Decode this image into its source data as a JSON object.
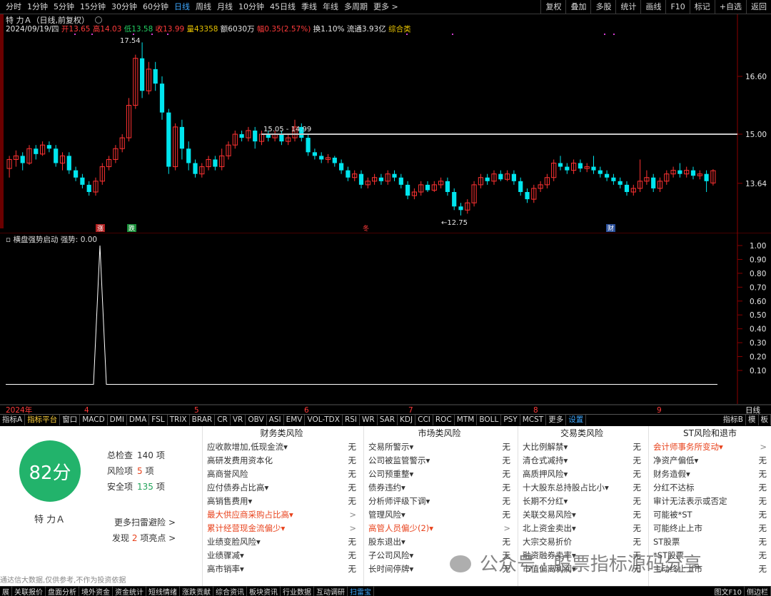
{
  "topbar": {
    "tabs": [
      "分时",
      "1分钟",
      "5分钟",
      "15分钟",
      "30分钟",
      "60分钟",
      "日线",
      "周线",
      "月线",
      "10分钟",
      "45日线",
      "季线",
      "年线",
      "多周期",
      "更多 >"
    ],
    "active_tab": "日线",
    "buttons": [
      "复权",
      "叠加",
      "多股",
      "统计",
      "画线",
      "F10",
      "标记",
      "+自选",
      "返回"
    ]
  },
  "title": {
    "text": "特 力Ａ（日线,前复权）"
  },
  "info": {
    "date": "2024/09/19/四",
    "open_label": "开",
    "open": "13.65",
    "high_label": "高",
    "high": "14.03",
    "low_label": "低",
    "low": "13.58",
    "close_label": "收",
    "close": "13.99",
    "vol_label": "量",
    "vol": "43358",
    "amt_label": "额",
    "amt": "6030万",
    "chg_label": "幅",
    "chg": "0.35(2.57%)",
    "turn_label": "换",
    "turn": "1.10%",
    "float_label": "流通",
    "float": "3.93亿",
    "sector": "综合类"
  },
  "main_chart": {
    "price_labels": [
      "16.60",
      "15.00",
      "13.64"
    ],
    "annotations": {
      "high": "17.54",
      "low": "←12.75",
      "line_label": "15.05 - 14.99"
    },
    "markers": [
      "涨",
      "跌",
      "冬",
      "财"
    ],
    "colors": {
      "up": "#ff3232",
      "down": "#00e5ee",
      "line": "#c8c8c8"
    }
  },
  "sub_chart": {
    "title": "横盘强势启动",
    "indicator": "强势: 0.00",
    "y_labels": [
      "1.00",
      "0.90",
      "0.80",
      "0.70",
      "0.60",
      "0.50",
      "0.40",
      "0.30",
      "0.20",
      "0.10"
    ]
  },
  "x_axis": {
    "labels": [
      "2024年",
      "4",
      "5",
      "6",
      "7",
      "8",
      "9"
    ],
    "right": "日线"
  },
  "bottombar": {
    "items": [
      "指标A",
      "指标平台",
      "窗口",
      "MACD",
      "DMI",
      "DMA",
      "FSL",
      "TRIX",
      "BRAR",
      "CR",
      "VR",
      "OBV",
      "ASI",
      "EMV",
      "VOL-TDX",
      "RSI",
      "WR",
      "SAR",
      "KDJ",
      "CCI",
      "ROC",
      "MTM",
      "BOLL",
      "PSY",
      "MCST",
      "更多",
      "设置"
    ],
    "right": [
      "指标B",
      "模",
      "板"
    ]
  },
  "panel": {
    "score": "82分",
    "stock_name": "特 力Ａ",
    "stats": [
      {
        "label": "总检查",
        "value": "140",
        "unit": "项",
        "color": "default"
      },
      {
        "label": "风险项",
        "value": "5",
        "unit": "项",
        "color": "red"
      },
      {
        "label": "安全项",
        "value": "135",
        "unit": "项",
        "color": "green"
      }
    ],
    "more_link": "更多扫雷避险 >",
    "highlight_prefix": "发现",
    "highlight_count": "2",
    "highlight_suffix": "项亮点 >",
    "columns": [
      {
        "title": "财务类风险",
        "rows": [
          {
            "label": "应收款增加,低现金流▾",
            "value": "无",
            "warn": false
          },
          {
            "label": "高研发费用资本化",
            "value": "无",
            "warn": false
          },
          {
            "label": "高商誉风险",
            "value": "无",
            "warn": false
          },
          {
            "label": "应付债券占比高▾",
            "value": "无",
            "warn": false
          },
          {
            "label": "高销售费用▾",
            "value": "无",
            "warn": false
          },
          {
            "label": "最大供应商采购占比高▾",
            "value": ">",
            "warn": true
          },
          {
            "label": "累计经营现金流偏少▾",
            "value": ">",
            "warn": true
          },
          {
            "label": "业绩变脸风险▾",
            "value": "无",
            "warn": false
          },
          {
            "label": "业绩骤减▾",
            "value": "无",
            "warn": false
          },
          {
            "label": "高市销率▾",
            "value": "无",
            "warn": false
          }
        ]
      },
      {
        "title": "市场类风险",
        "rows": [
          {
            "label": "交易所警示▾",
            "value": "无",
            "warn": false
          },
          {
            "label": "公司被监管警示▾",
            "value": "无",
            "warn": false
          },
          {
            "label": "公司预重整▾",
            "value": "无",
            "warn": false
          },
          {
            "label": "债券违约▾",
            "value": "无",
            "warn": false
          },
          {
            "label": "分析师评级下调▾",
            "value": "无",
            "warn": false
          },
          {
            "label": "管理风险▾",
            "value": "无",
            "warn": false
          },
          {
            "label": "高管人员偏少(2)▾",
            "value": ">",
            "warn": true
          },
          {
            "label": "股东退出▾",
            "value": "无",
            "warn": false
          },
          {
            "label": "子公司风险▾",
            "value": "无",
            "warn": false
          },
          {
            "label": "长时间停牌▾",
            "value": "无",
            "warn": false
          }
        ]
      },
      {
        "title": "交易类风险",
        "rows": [
          {
            "label": "大比例解禁▾",
            "value": "无",
            "warn": false
          },
          {
            "label": "清仓式减持▾",
            "value": "无",
            "warn": false
          },
          {
            "label": "高质押风险▾",
            "value": "无",
            "warn": false
          },
          {
            "label": "十大股东总持股占比小▾",
            "value": "无",
            "warn": false
          },
          {
            "label": "长期不分红▾",
            "value": "无",
            "warn": false
          },
          {
            "label": "关联交易风险▾",
            "value": "无",
            "warn": false
          },
          {
            "label": "北上资金卖出▾",
            "value": "无",
            "warn": false
          },
          {
            "label": "大宗交易折价",
            "value": "无",
            "warn": false
          },
          {
            "label": "融资融券卖率▾",
            "value": "无",
            "warn": false
          },
          {
            "label": "市值偏离利润▾",
            "value": "无",
            "warn": false
          }
        ]
      },
      {
        "title": "ST风险和退市",
        "rows": [
          {
            "label": "会计师事务所变动▾",
            "value": ">",
            "warn": true
          },
          {
            "label": "净资产偏低▾",
            "value": "无",
            "warn": false
          },
          {
            "label": "财务造假▾",
            "value": "无",
            "warn": false
          },
          {
            "label": "分红不达标",
            "value": "无",
            "warn": false
          },
          {
            "label": "审计无法表示或否定",
            "value": "无",
            "warn": false
          },
          {
            "label": "可能被*ST",
            "value": "无",
            "warn": false
          },
          {
            "label": "可能终止上市",
            "value": "无",
            "warn": false
          },
          {
            "label": "ST股票",
            "value": "无",
            "warn": false
          },
          {
            "label": "*ST股票",
            "value": "无",
            "warn": false
          },
          {
            "label": "主动终止上市",
            "value": "无",
            "warn": false
          }
        ]
      }
    ],
    "disclaimer": "通达信大数据,仅供参考,不作为投资依据"
  },
  "watermark": "公众号 · 股票指标源码分享",
  "footer": {
    "items": [
      "展",
      "关联报价",
      "盘面分析",
      "境外资金",
      "资金统计",
      "短线情绪",
      "涨跌贡献",
      "综合资讯",
      "板块资讯",
      "行业数据",
      "互动调研",
      "扫雷宝"
    ],
    "right": [
      "图文F10",
      "侧边栏"
    ]
  }
}
